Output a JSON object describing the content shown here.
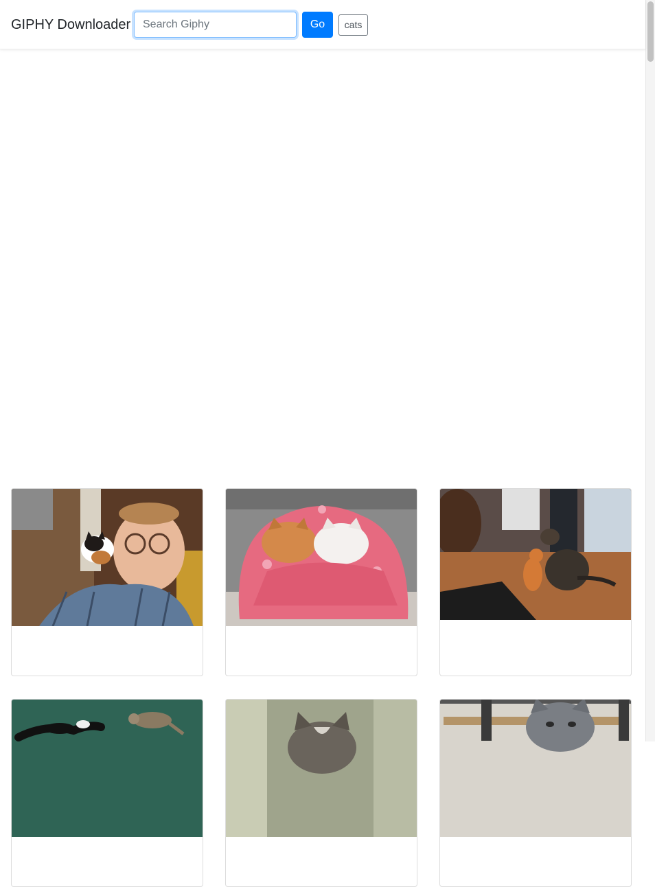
{
  "header": {
    "brand": "GIPHY Downloader",
    "search_placeholder": "Search Giphy",
    "search_value": "",
    "go_label": "Go",
    "tags": [
      "cats"
    ]
  },
  "results": [
    {
      "image": "man-with-glasses-holding-kitten"
    },
    {
      "image": "two-cats-in-pink-blanket"
    },
    {
      "image": "kitten-pawing-at-cat-on-wood-floor"
    },
    {
      "image": "cats-jumping-in-air"
    },
    {
      "image": "tabby-kitten-face"
    },
    {
      "image": "gray-cat-in-box"
    }
  ],
  "colors": {
    "primary": "#007bff",
    "card_border": "#dcdcdc"
  }
}
